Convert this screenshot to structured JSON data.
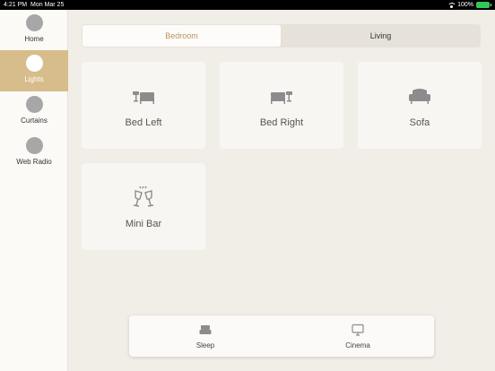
{
  "status_bar": {
    "time": "4:21 PM",
    "date": "Mon Mar 25",
    "battery": "100%"
  },
  "sidebar": {
    "items": [
      {
        "label": "Home",
        "active": false
      },
      {
        "label": "Lights",
        "active": true
      },
      {
        "label": "Curtains",
        "active": false
      },
      {
        "label": "Web Radio",
        "active": false
      }
    ]
  },
  "tabs": [
    {
      "label": "Bedroom",
      "active": true
    },
    {
      "label": "Living",
      "active": false
    }
  ],
  "lights": [
    {
      "label": "Bed Left",
      "icon": "bed-lamp-left-icon"
    },
    {
      "label": "Bed Right",
      "icon": "bed-lamp-right-icon"
    },
    {
      "label": "Sofa",
      "icon": "sofa-icon"
    },
    {
      "label": "Mini Bar",
      "icon": "wine-glasses-icon"
    }
  ],
  "scenes": [
    {
      "label": "Sleep",
      "icon": "bed-icon"
    },
    {
      "label": "Cinema",
      "icon": "tv-icon"
    }
  ],
  "colors": {
    "accent": "#d7bd8b",
    "tab_accent": "#b8945b",
    "background": "#f1eee7",
    "battery": "#33c759"
  }
}
